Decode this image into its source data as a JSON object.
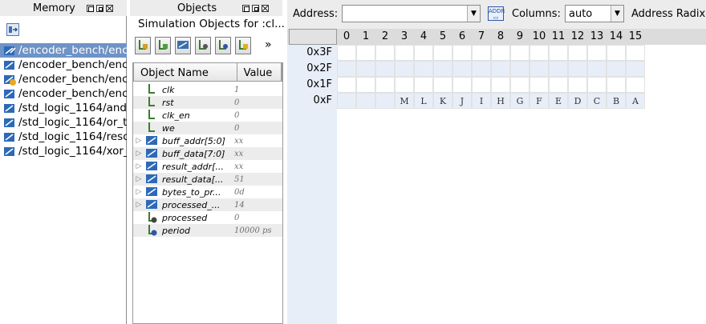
{
  "memory_pane": {
    "title": "Memory",
    "items": [
      {
        "label": "/encoder_bench/enc",
        "selected": true,
        "icon": "memory-write-icon"
      },
      {
        "label": "/encoder_bench/enc",
        "selected": false,
        "icon": "memory-icon"
      },
      {
        "label": "/encoder_bench/enc",
        "selected": false,
        "icon": "memory-warning-icon"
      },
      {
        "label": "/encoder_bench/enc",
        "selected": false,
        "icon": "memory-icon"
      },
      {
        "label": "/std_logic_1164/and",
        "selected": false,
        "icon": "memory-icon"
      },
      {
        "label": "/std_logic_1164/or_t",
        "selected": false,
        "icon": "memory-icon"
      },
      {
        "label": "/std_logic_1164/reso",
        "selected": false,
        "icon": "memory-icon"
      },
      {
        "label": "/std_logic_1164/xor_",
        "selected": false,
        "icon": "memory-icon"
      }
    ]
  },
  "objects_pane": {
    "title": "Objects",
    "subtitle": "Simulation Objects for :cl...",
    "overflow": "»",
    "columns": {
      "name": "Object Name",
      "value": "Value"
    },
    "rows": [
      {
        "name": "clk",
        "value": "1",
        "expand": "",
        "kind": "signal"
      },
      {
        "name": "rst",
        "value": "0",
        "expand": "",
        "kind": "signal"
      },
      {
        "name": "clk_en",
        "value": "0",
        "expand": "",
        "kind": "signal"
      },
      {
        "name": "we",
        "value": "0",
        "expand": "",
        "kind": "signal"
      },
      {
        "name": "buff_addr[5:0]",
        "value": "xx",
        "expand": "▷",
        "kind": "bus"
      },
      {
        "name": "buff_data[7:0]",
        "value": "xx",
        "expand": "▷",
        "kind": "bus"
      },
      {
        "name": "result_addr[...",
        "value": "xx",
        "expand": "▷",
        "kind": "bus"
      },
      {
        "name": "result_data[...",
        "value": "51",
        "expand": "▷",
        "kind": "bus"
      },
      {
        "name": "bytes_to_pr...",
        "value": "0d",
        "expand": "▷",
        "kind": "bus"
      },
      {
        "name": "processed_...",
        "value": "14",
        "expand": "▷",
        "kind": "bus"
      },
      {
        "name": "processed",
        "value": "0",
        "expand": "",
        "kind": "signal"
      },
      {
        "name": "period",
        "value": "10000 ps",
        "expand": "",
        "kind": "constant"
      }
    ]
  },
  "memory_view": {
    "address_label": "Address:",
    "address_value": "",
    "columns_label": "Columns:",
    "columns_value": "auto",
    "radix_label": "Address Radix",
    "col_headers": [
      "0",
      "1",
      "2",
      "3",
      "4",
      "5",
      "6",
      "7",
      "8",
      "9",
      "10",
      "11",
      "12",
      "13",
      "14",
      "15"
    ],
    "rows": [
      {
        "addr": "0x3F",
        "cells": [
          "",
          "",
          "",
          "",
          "",
          "",
          "",
          "",
          "",
          "",
          "",
          "",
          "",
          "",
          "",
          ""
        ]
      },
      {
        "addr": "0x2F",
        "cells": [
          "",
          "",
          "",
          "",
          "",
          "",
          "",
          "",
          "",
          "",
          "",
          "",
          "",
          "",
          "",
          ""
        ]
      },
      {
        "addr": "0x1F",
        "cells": [
          "",
          "",
          "",
          "",
          "",
          "",
          "",
          "",
          "",
          "",
          "",
          "",
          "",
          "",
          "",
          ""
        ]
      },
      {
        "addr": "0xF",
        "cells": [
          "",
          "",
          "",
          "M",
          "L",
          "K",
          "J",
          "I",
          "H",
          "G",
          "F",
          "E",
          "D",
          "C",
          "B",
          "A"
        ]
      }
    ]
  },
  "colors": {
    "selection": "#6e93c6",
    "band": "#e8eef8",
    "accent": "#1b6fb8"
  }
}
